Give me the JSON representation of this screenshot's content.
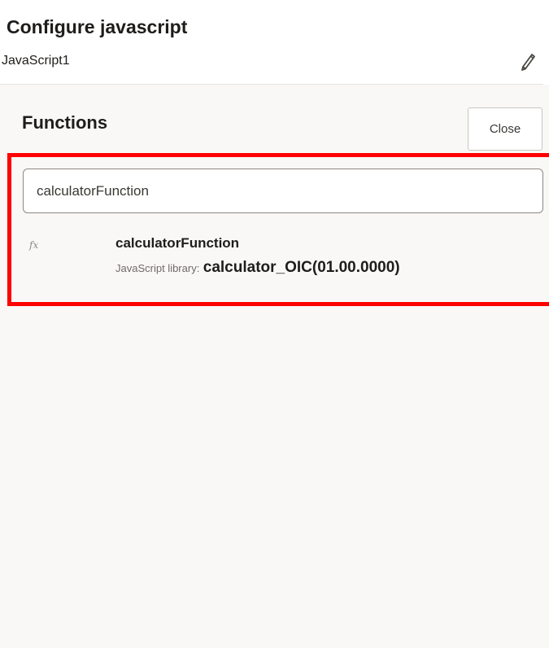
{
  "header": {
    "title": "Configure javascript",
    "subtitle": "JavaScript1",
    "edit_icon": "pencil-icon"
  },
  "functions": {
    "title": "Functions",
    "close_label": "Close",
    "search": {
      "value": "calculatorFunction",
      "placeholder": ""
    },
    "results": [
      {
        "icon": "fx-icon",
        "icon_glyph": "fx",
        "name": "calculatorFunction",
        "library_label": "JavaScript library:",
        "library_value": "calculator_OIC(01.00.0000)"
      }
    ]
  },
  "colors": {
    "highlight": "#ff0000",
    "panel_bg": "#f9f8f7",
    "text": "#1f1d1b"
  }
}
